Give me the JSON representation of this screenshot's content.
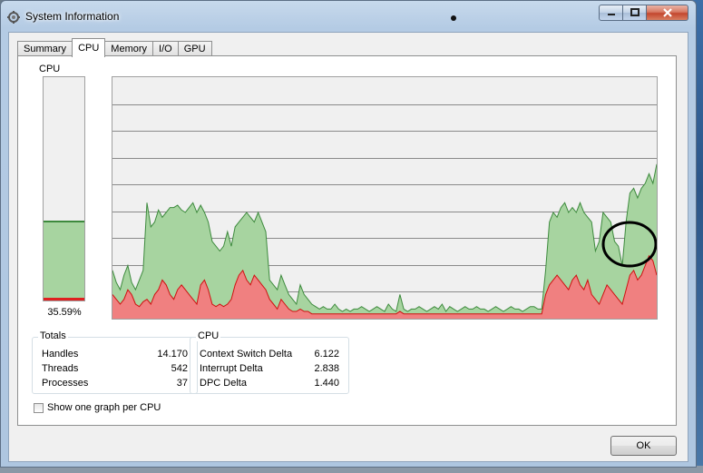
{
  "window": {
    "title": "System Information",
    "app_icon": "system-info-icon"
  },
  "tabs": [
    {
      "label": "Summary",
      "active": false
    },
    {
      "label": "CPU",
      "active": true
    },
    {
      "label": "Memory",
      "active": false
    },
    {
      "label": "I/O",
      "active": false
    },
    {
      "label": "GPU",
      "active": false
    }
  ],
  "cpu_panel": {
    "meter_label": "CPU",
    "usage_percent_text": "35.59%",
    "usage_fraction": 0.3559,
    "kernel_fraction": 0.012
  },
  "totals": {
    "title": "Totals",
    "rows": [
      {
        "label": "Handles",
        "value": "14.170"
      },
      {
        "label": "Threads",
        "value": "542"
      },
      {
        "label": "Processes",
        "value": "37"
      }
    ]
  },
  "cpu_stats": {
    "title": "CPU",
    "rows": [
      {
        "label": "Context Switch Delta",
        "value": "6.122"
      },
      {
        "label": "Interrupt Delta",
        "value": "2.838"
      },
      {
        "label": "DPC Delta",
        "value": "1.440"
      }
    ]
  },
  "options": {
    "per_cpu_graph_label": "Show one graph per CPU",
    "per_cpu_graph_checked": false
  },
  "buttons": {
    "ok_label": "OK"
  },
  "colors": {
    "total_fill": "#a7d4a0",
    "total_line": "#3d8a3d",
    "kernel_fill": "#f08080",
    "kernel_line": "#d01010",
    "annotation": "#000000"
  },
  "chart_data": {
    "type": "area",
    "ylim": [
      0,
      100
    ],
    "gridlines": 9,
    "series": [
      {
        "values": [
          20,
          15,
          12,
          18,
          22,
          15,
          12,
          16,
          20,
          48,
          38,
          40,
          45,
          42,
          44,
          46,
          46,
          47,
          45,
          44,
          46,
          48,
          44,
          47,
          44,
          40,
          32,
          30,
          28,
          30,
          36,
          30,
          38,
          40,
          42,
          44,
          42,
          40,
          44,
          40,
          36,
          16,
          14,
          12,
          18,
          14,
          10,
          8,
          6,
          14,
          10,
          8,
          6,
          5,
          4,
          5,
          4,
          4,
          6,
          4,
          3,
          4,
          3,
          4,
          4,
          5,
          4,
          3,
          4,
          5,
          4,
          3,
          6,
          4,
          3,
          10,
          4,
          3,
          4,
          4,
          5,
          4,
          3,
          4,
          5,
          4,
          6,
          3,
          5,
          4,
          3,
          4,
          5,
          4,
          4,
          5,
          4,
          4,
          3,
          4,
          5,
          4,
          3,
          4,
          5,
          4,
          4,
          3,
          4,
          5,
          5,
          4,
          4,
          20,
          40,
          44,
          42,
          46,
          48,
          44,
          46,
          44,
          48,
          44,
          42,
          40,
          28,
          32,
          44,
          42,
          40,
          32,
          30,
          22,
          40,
          52,
          54,
          50,
          54,
          56,
          60,
          56,
          64
        ]
      },
      {
        "values": [
          10,
          8,
          6,
          8,
          12,
          10,
          6,
          5,
          7,
          8,
          6,
          10,
          12,
          16,
          14,
          10,
          8,
          12,
          14,
          12,
          10,
          8,
          6,
          14,
          16,
          12,
          6,
          5,
          6,
          5,
          6,
          8,
          14,
          18,
          20,
          16,
          14,
          18,
          16,
          14,
          12,
          8,
          6,
          4,
          8,
          6,
          4,
          3,
          3,
          4,
          3,
          3,
          2,
          2,
          2,
          2,
          2,
          2,
          2,
          2,
          2,
          2,
          2,
          2,
          2,
          2,
          2,
          2,
          2,
          2,
          2,
          2,
          2,
          2,
          2,
          3,
          2,
          2,
          2,
          2,
          2,
          2,
          2,
          2,
          2,
          2,
          2,
          2,
          2,
          2,
          2,
          2,
          2,
          2,
          2,
          2,
          2,
          2,
          2,
          2,
          2,
          2,
          2,
          2,
          2,
          2,
          2,
          2,
          2,
          2,
          2,
          2,
          2,
          10,
          14,
          16,
          18,
          16,
          14,
          12,
          16,
          18,
          14,
          12,
          16,
          10,
          8,
          6,
          10,
          14,
          12,
          10,
          8,
          6,
          12,
          18,
          20,
          16,
          18,
          22,
          26,
          24,
          18
        ]
      }
    ]
  }
}
